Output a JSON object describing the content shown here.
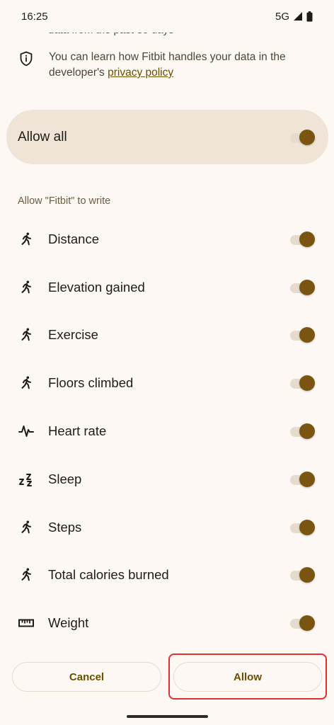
{
  "status_bar": {
    "time": "16:25",
    "network": "5G"
  },
  "header": {
    "clipped_text": "data from the past 30 days",
    "privacy_note_prefix": "You can learn how Fitbit handles your data in the developer's ",
    "privacy_link": "privacy policy"
  },
  "allow_all": {
    "label": "Allow all",
    "enabled": true
  },
  "section": {
    "title": "Allow \"Fitbit\" to write"
  },
  "permissions": [
    {
      "label": "Distance",
      "icon": "running-icon",
      "enabled": true
    },
    {
      "label": "Elevation gained",
      "icon": "running-icon",
      "enabled": true
    },
    {
      "label": "Exercise",
      "icon": "running-icon",
      "enabled": true
    },
    {
      "label": "Floors climbed",
      "icon": "running-icon",
      "enabled": true
    },
    {
      "label": "Heart rate",
      "icon": "heart-rate-icon",
      "enabled": true
    },
    {
      "label": "Sleep",
      "icon": "sleep-icon",
      "enabled": true
    },
    {
      "label": "Steps",
      "icon": "running-icon",
      "enabled": true
    },
    {
      "label": "Total calories burned",
      "icon": "running-icon",
      "enabled": true
    },
    {
      "label": "Weight",
      "icon": "ruler-icon",
      "enabled": true
    }
  ],
  "actions": {
    "cancel_label": "Cancel",
    "allow_label": "Allow"
  },
  "colors": {
    "accent": "#7a5511",
    "highlight": "#e02f2f",
    "card": "#efe4d6"
  }
}
